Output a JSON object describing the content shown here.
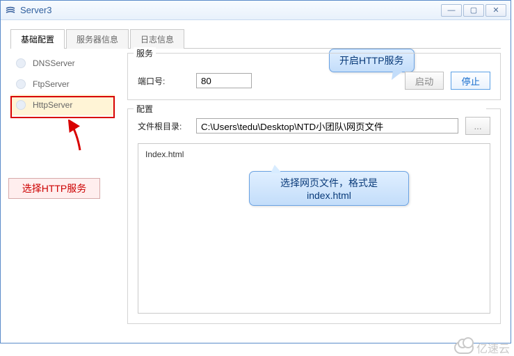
{
  "window": {
    "title": "Server3"
  },
  "tabs": {
    "t0": "基础配置",
    "t1": "服务器信息",
    "t2": "日志信息"
  },
  "sidebar": {
    "items": {
      "0": {
        "label": "DNSServer"
      },
      "1": {
        "label": "FtpServer"
      },
      "2": {
        "label": "HttpServer"
      }
    }
  },
  "callouts": {
    "select_http": "选择HTTP服务",
    "start_http": "开启HTTP服务",
    "choose_file": "选择网页文件，格式是index.html"
  },
  "service": {
    "legend": "服务",
    "port_label": "端口号:",
    "port_value": "80",
    "start_btn": "启动",
    "stop_btn": "停止"
  },
  "config": {
    "legend": "配置",
    "root_label": "文件根目录:",
    "root_value": "C:\\Users\\tedu\\Desktop\\NTD小团队\\网页文件",
    "browse_btn": "...",
    "listing": "Index.html"
  },
  "watermark": "亿速云"
}
